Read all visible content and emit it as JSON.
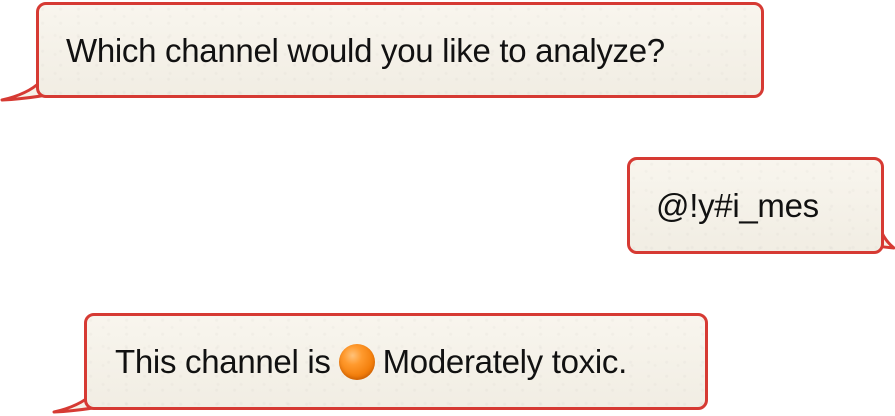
{
  "conversation": {
    "messages": [
      {
        "sender": "bot",
        "text": "Which channel would you like to analyze?"
      },
      {
        "sender": "user",
        "text": "@!y#i_mes"
      },
      {
        "sender": "bot",
        "prefix": "This channel is",
        "status_icon": "orange-circle-icon",
        "status_color": "#f37f0c",
        "status_text": "Moderately toxic."
      }
    ]
  },
  "theme": {
    "bubble_background": "#f6f2e8",
    "bubble_border": "#d63a33",
    "text_color": "#111111",
    "page_background": "#ffffff"
  }
}
